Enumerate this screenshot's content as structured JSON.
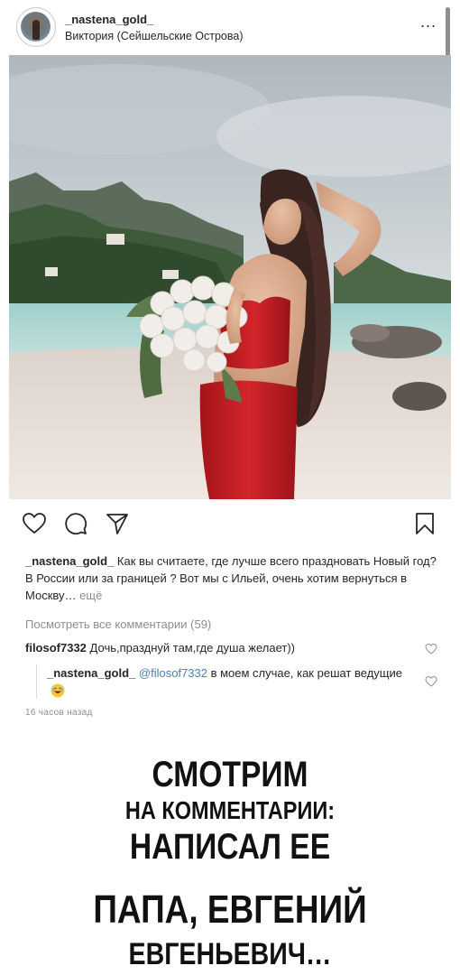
{
  "post": {
    "username": "_nastena_gold_",
    "location": "Виктория (Сейшельские Острова)",
    "more_label": "...",
    "photo_icon": "post-photo-beach-woman-roses"
  },
  "actions": {
    "icons": [
      "heart-icon",
      "comment-icon",
      "share-icon",
      "save-icon"
    ]
  },
  "caption": {
    "username": "_nastena_gold_",
    "text": "Как вы считаете, где лучше всего праздновать Новый год? В России или за границей ? Вот мы с Ильей, очень хотим вернуться в Москву…",
    "more_label": "ещё"
  },
  "comments": {
    "view_all_label": "Посмотреть все комментарии (59)",
    "items": [
      {
        "username": "filosof7332",
        "text": "Дочь,празднуй там,где душа желает))"
      }
    ],
    "reply": {
      "username": "_nastena_gold_",
      "mention": "@filosof7332",
      "text": "в моем случае, как решат ведущие"
    },
    "timestamp": "16 часов назад"
  },
  "overlay": {
    "line1": "СМОТРИМ",
    "line2": "НА КОММЕНТАРИИ:",
    "line3": "НАПИСАЛ ЕЕ",
    "line4": "ПАПА, ЕВГЕНИЙ",
    "line5": "ЕВГЕНЬЕВИЧ…"
  },
  "colors": {
    "text": "#262626",
    "muted": "#8e8e8e",
    "mention": "#4b7fb6",
    "dress": "#c81e22"
  }
}
